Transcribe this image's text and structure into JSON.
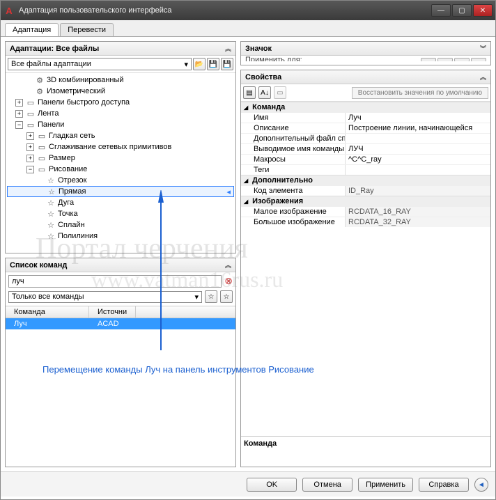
{
  "window": {
    "title": "Адаптация пользовательского интерфейса",
    "app_icon": "A"
  },
  "tabs": {
    "adapt": "Адаптация",
    "translate": "Перевести"
  },
  "adapt_panel": {
    "title": "Адаптации: Все файлы",
    "dropdown": "Все файлы адаптации"
  },
  "tree": {
    "n1": "3D комбинированный",
    "n2": "Изометрический",
    "n3": "Панели быстрого доступа",
    "n4": "Лента",
    "n5": "Панели",
    "n5c1": "Гладкая сеть",
    "n5c2": "Сглаживание сетевых примитивов",
    "n5c3": "Размер",
    "n5c4": "Рисование",
    "d1": "Отрезок",
    "d2": "Прямая",
    "d3": "Дуга",
    "d4": "Точка",
    "d5": "Сплайн",
    "d6": "Полилиния"
  },
  "cmdlist": {
    "title": "Список команд",
    "search_value": "луч",
    "filter": "Только все команды",
    "col1": "Команда",
    "col2": "Источни",
    "row1_cmd": "Луч",
    "row1_src": "ACAD"
  },
  "right": {
    "icon_title": "Значок",
    "apply_label": "Применить для:",
    "props_title": "Свойства",
    "restore": "Восстановить значения по умолчанию",
    "cat_cmd": "Команда",
    "cat_extra": "Дополнительно",
    "cat_img": "Изображения",
    "help_title": "Команда",
    "props": {
      "name_k": "Имя",
      "name_v": "Луч",
      "desc_k": "Описание",
      "desc_v": "Построение линии, начинающейся",
      "file_k": "Дополнительный файл спра",
      "disp_k": "Выводимое имя команды",
      "disp_v": "ЛУЧ",
      "macro_k": "Макросы",
      "macro_v": "^C^C_ray",
      "tags_k": "Теги",
      "elem_k": "Код элемента",
      "elem_v": "ID_Ray",
      "small_k": "Малое изображение",
      "small_v": "RCDATA_16_RAY",
      "large_k": "Большое изображение",
      "large_v": "RCDATA_32_RAY"
    }
  },
  "footer": {
    "ok": "OK",
    "cancel": "Отмена",
    "apply": "Применить",
    "help": "Справка"
  },
  "annotation": "Перемещение команды Луч на панель инструментов Рисование",
  "watermark1": "Портал черчения",
  "watermark2": "www.vatman16rus.ru"
}
